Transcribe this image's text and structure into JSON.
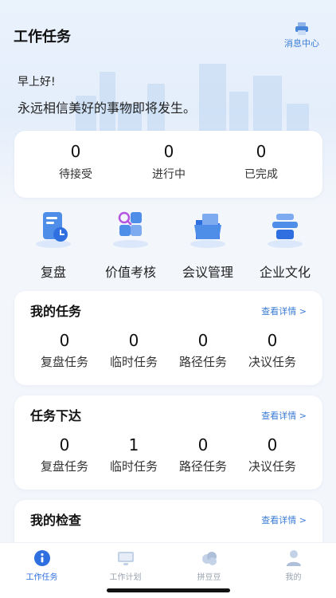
{
  "header": {
    "title": "工作任务",
    "message_center_label": "消息中心",
    "message_icon": "printer-icon"
  },
  "greeting": "早上好!",
  "motto": "永远相信美好的事物即将发生。",
  "status_stats": [
    {
      "count": "0",
      "label": "待接受"
    },
    {
      "count": "0",
      "label": "进行中"
    },
    {
      "count": "0",
      "label": "已完成"
    }
  ],
  "shortcuts": [
    {
      "label": "复盘",
      "icon": "review-document-icon"
    },
    {
      "label": "价值考核",
      "icon": "value-assessment-icon"
    },
    {
      "label": "会议管理",
      "icon": "meeting-folder-icon"
    },
    {
      "label": "企业文化",
      "icon": "corporate-culture-icon"
    }
  ],
  "sections": [
    {
      "title": "我的任务",
      "more_label": "查看详情 >",
      "items": [
        {
          "count": "0",
          "label": "复盘任务"
        },
        {
          "count": "0",
          "label": "临时任务"
        },
        {
          "count": "0",
          "label": "路径任务"
        },
        {
          "count": "0",
          "label": "决议任务"
        }
      ]
    },
    {
      "title": "任务下达",
      "more_label": "查看详情 >",
      "items": [
        {
          "count": "0",
          "label": "复盘任务"
        },
        {
          "count": "1",
          "label": "临时任务"
        },
        {
          "count": "0",
          "label": "路径任务"
        },
        {
          "count": "0",
          "label": "决议任务"
        }
      ]
    },
    {
      "title": "我的检查",
      "more_label": "查看详情 >",
      "items": []
    }
  ],
  "tabbar": [
    {
      "label": "工作任务",
      "icon": "info-circle-icon",
      "active": true
    },
    {
      "label": "工作计划",
      "icon": "monitor-icon",
      "active": false
    },
    {
      "label": "拼豆豆",
      "icon": "cloud-icon",
      "active": false
    },
    {
      "label": "我的",
      "icon": "user-icon",
      "active": false
    }
  ],
  "colors": {
    "accent": "#3a7bd5",
    "active_tab": "#2f6fe0",
    "background": "#f3f6fb"
  }
}
